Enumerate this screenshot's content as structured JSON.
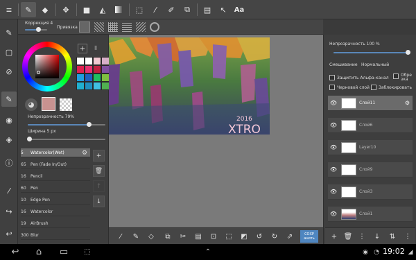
{
  "colors": {
    "accent": "#5a87b8",
    "selected_layer": "#6b6b6b",
    "canvas_bg": "#7a7a7a"
  },
  "toolbar": {
    "icons": [
      "pen-icon",
      "eraser-icon",
      "transform-icon",
      "fill-rect-icon",
      "bucket-icon",
      "gradient-icon",
      "select-rect-icon",
      "magic-wand-icon",
      "select-pen-icon",
      "select-add-icon",
      "filter-icon",
      "move-icon"
    ],
    "text_tool": "Aa"
  },
  "subbar": {
    "correction_label": "Коррекция 4",
    "snap_label": "Привязка"
  },
  "left_panel": {
    "palette_colors": [
      "#ffffff",
      "#ffffff",
      "#f0c8d0",
      "#d8b0c8",
      "#e02050",
      "#e83070",
      "#c02040",
      "#8050a0",
      "#20a0e0",
      "#2060c0",
      "#20c060",
      "#80c040",
      "#20b0d0",
      "#2090c0",
      "#40c0e0",
      "#50b050"
    ],
    "opacity_label": "Непрозрачность 79%",
    "opacity_value": 0.79,
    "width_label": "Ширина 5 px",
    "brushes": [
      {
        "size": "5",
        "name": "Watercolor(Wet)"
      },
      {
        "size": "65",
        "name": "Pen (Fade In/Out)"
      },
      {
        "size": "16",
        "name": "Pencil"
      },
      {
        "size": "60",
        "name": "Pen"
      },
      {
        "size": "10",
        "name": "Edge Pen"
      },
      {
        "size": "16",
        "name": "Watercolor"
      },
      {
        "size": "19",
        "name": "AirBrush"
      },
      {
        "size": "300",
        "name": "Blur"
      }
    ]
  },
  "canvas": {
    "signature_year": "2016",
    "signature": "XTRO"
  },
  "bottombar": {
    "save_label": "СОХР\nанить"
  },
  "right_panel": {
    "opacity_label": "Непрозрачность 100 %",
    "opacity_value": 1.0,
    "blend_label": "Смешивание",
    "blend_value": "Нормальный",
    "chk_alpha": "Защитить Альфа-канал",
    "chk_clip": "Обре зка",
    "chk_draft": "Черновой слой",
    "chk_lock": "Заблокировать",
    "layers": [
      {
        "name": "Слой11",
        "selected": true
      },
      {
        "name": "Слой6",
        "selected": false
      },
      {
        "name": "Layer10",
        "selected": false
      },
      {
        "name": "Слой9",
        "selected": false
      },
      {
        "name": "Слой3",
        "selected": false
      },
      {
        "name": "Слой1",
        "selected": false
      }
    ]
  },
  "status": {
    "time": "19:02"
  }
}
